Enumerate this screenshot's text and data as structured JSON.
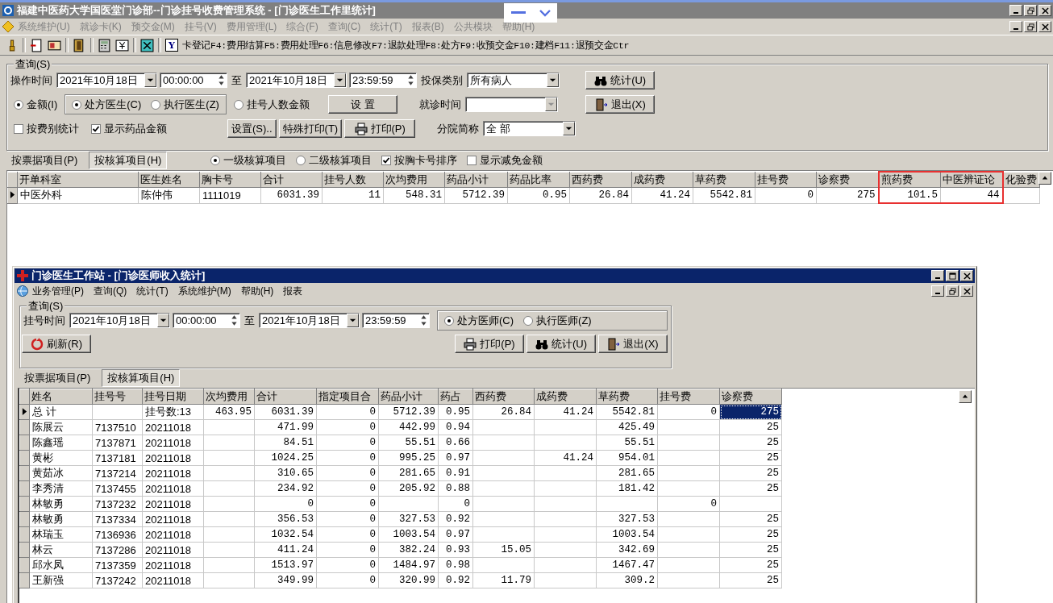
{
  "window": {
    "title": "福建中医药大学国医堂门诊部--门诊挂号收费管理系统 - [门诊医生工作里统计]"
  },
  "menu": [
    "系统维护(U)",
    "就诊卡(K)",
    "预交金(M)",
    "挂号(V)",
    "费用管理(L)",
    "综合(F)",
    "查询(C)",
    "统计(T)",
    "报表(B)",
    "公共模块",
    "帮助(H)"
  ],
  "toolbar": {
    "key_label": "Y",
    "shortcuts": "卡登记F4:费用结算F5:费用处理F6:信息修改F7:退款处理F8:处方F9:收预交金F10:建档F11:退预交金Ctr"
  },
  "query": {
    "legend": "查询(S)",
    "time_label": "操作时间",
    "date_from": "2021年10月18日",
    "time_from": "00:00:00",
    "to": "至",
    "date_to": "2021年10月18日",
    "time_to": "23:59:59",
    "insurance_label": "投保类别",
    "insurance": "所有病人",
    "stat_button": "统计(U)",
    "mode_radios": [
      {
        "label": "金额(I)",
        "selected": true
      },
      {
        "label": "挂号人数金额",
        "selected": false
      }
    ],
    "doctor_radios": [
      {
        "label": "处方医生(C)",
        "selected": true
      },
      {
        "label": "执行医生(Z)",
        "selected": false
      }
    ],
    "setup_button": "设 置",
    "visit_time_label": "就诊时间",
    "exit_button": "退出(X)",
    "checkboxes": [
      {
        "label": "按费别统计",
        "checked": false
      },
      {
        "label": "显示药品金额",
        "checked": true
      }
    ],
    "settings_button": "设置(S)..",
    "special_print_button": "特殊打印(T)",
    "print_button": "打印(P)",
    "branch_label": "分院简称",
    "branch": "全 部"
  },
  "tabs": [
    {
      "label": "按票据项目(P)",
      "selected": false
    },
    {
      "label": "按核算项目(H)",
      "selected": true
    }
  ],
  "level_radios": [
    {
      "label": "一级核算项目",
      "selected": true
    },
    {
      "label": "二级核算项目",
      "selected": false
    }
  ],
  "sort_checkboxes": [
    {
      "label": "按胸卡号排序",
      "checked": true
    },
    {
      "label": "显示减免金额",
      "checked": false
    }
  ],
  "main_grid": {
    "columns": [
      {
        "label": "开单科室",
        "kind": "text",
        "highlighted": false
      },
      {
        "label": "医生姓名",
        "kind": "text",
        "highlighted": false
      },
      {
        "label": "胸卡号",
        "kind": "text",
        "highlighted": false
      },
      {
        "label": "合计",
        "kind": "number",
        "highlighted": false
      },
      {
        "label": "挂号人数",
        "kind": "number",
        "highlighted": false
      },
      {
        "label": "次均费用",
        "kind": "number",
        "highlighted": false
      },
      {
        "label": "药品小计",
        "kind": "number",
        "highlighted": false
      },
      {
        "label": "药品比率",
        "kind": "number",
        "highlighted": false
      },
      {
        "label": "西药费",
        "kind": "number",
        "highlighted": false
      },
      {
        "label": "成药费",
        "kind": "number",
        "highlighted": false
      },
      {
        "label": "草药费",
        "kind": "number",
        "highlighted": false
      },
      {
        "label": "挂号费",
        "kind": "number",
        "highlighted": false
      },
      {
        "label": "诊察费",
        "kind": "number",
        "highlighted": false
      },
      {
        "label": "煎药费",
        "kind": "number",
        "highlighted": true
      },
      {
        "label": "中医辨证论",
        "kind": "number",
        "highlighted": true
      },
      {
        "label": "化验费",
        "kind": "number",
        "highlighted": false
      }
    ],
    "rows": [
      {
        "selected": true,
        "cells": [
          "中医外科",
          "陈仲伟",
          "1111019",
          "6031.39",
          "11",
          "548.31",
          "5712.39",
          "0.95",
          "26.84",
          "41.24",
          "5542.81",
          "0",
          "275",
          "101.5",
          "44",
          null
        ]
      }
    ]
  },
  "sub_window": {
    "title": "门诊医生工作站 - [门诊医师收入统计]",
    "menu": [
      "业务管理(P)",
      "查询(Q)",
      "统计(T)",
      "系统维护(M)",
      "帮助(H)",
      "报表"
    ],
    "query": {
      "legend": "查询(S)",
      "time_label": "挂号时间",
      "date_from": "2021年10月18日",
      "time_from": "00:00:00",
      "to": "至",
      "date_to": "2021年10月18日",
      "time_to": "23:59:59",
      "doctor_radios": [
        {
          "label": "处方医师(C)",
          "selected": true
        },
        {
          "label": "执行医师(Z)",
          "selected": false
        }
      ],
      "refresh_button": "刷新(R)",
      "print_button": "打印(P)",
      "stat_button": "统计(U)",
      "exit_button": "退出(X)"
    },
    "tabs": [
      {
        "label": "按票据项目(P)",
        "selected": false
      },
      {
        "label": "按核算项目(H)",
        "selected": true
      }
    ],
    "grid": {
      "columns": [
        {
          "label": "姓名",
          "kind": "text"
        },
        {
          "label": "挂号号",
          "kind": "text"
        },
        {
          "label": "挂号日期",
          "kind": "text"
        },
        {
          "label": "次均费用",
          "kind": "number"
        },
        {
          "label": "合计",
          "kind": "number"
        },
        {
          "label": "指定项目合",
          "kind": "number"
        },
        {
          "label": "药品小计",
          "kind": "number"
        },
        {
          "label": "药占",
          "kind": "number"
        },
        {
          "label": "西药费",
          "kind": "number"
        },
        {
          "label": "成药费",
          "kind": "number"
        },
        {
          "label": "草药费",
          "kind": "number"
        },
        {
          "label": "挂号费",
          "kind": "number"
        },
        {
          "label": "诊察费",
          "kind": "number"
        }
      ],
      "rows": [
        {
          "selected": true,
          "focused": true,
          "cells": [
            "总 计",
            null,
            "挂号数:13",
            "463.95",
            "6031.39",
            "0",
            "5712.39",
            "0.95",
            "26.84",
            "41.24",
            "5542.81",
            "0",
            "275"
          ]
        },
        {
          "selected": false,
          "focused": false,
          "cells": [
            "陈展云",
            "7137510",
            "20211018",
            null,
            "471.99",
            "0",
            "442.99",
            "0.94",
            null,
            null,
            "425.49",
            null,
            "25"
          ]
        },
        {
          "selected": false,
          "focused": false,
          "cells": [
            "陈鑫瑶",
            "7137871",
            "20211018",
            null,
            "84.51",
            "0",
            "55.51",
            "0.66",
            null,
            null,
            "55.51",
            null,
            "25"
          ]
        },
        {
          "selected": false,
          "focused": false,
          "cells": [
            "黄彬",
            "7137181",
            "20211018",
            null,
            "1024.25",
            "0",
            "995.25",
            "0.97",
            null,
            "41.24",
            "954.01",
            null,
            "25"
          ]
        },
        {
          "selected": false,
          "focused": false,
          "cells": [
            "黄茹冰",
            "7137214",
            "20211018",
            null,
            "310.65",
            "0",
            "281.65",
            "0.91",
            null,
            null,
            "281.65",
            null,
            "25"
          ]
        },
        {
          "selected": false,
          "focused": false,
          "cells": [
            "李秀清",
            "7137455",
            "20211018",
            null,
            "234.92",
            "0",
            "205.92",
            "0.88",
            null,
            null,
            "181.42",
            null,
            "25"
          ]
        },
        {
          "selected": false,
          "focused": false,
          "cells": [
            "林敏勇",
            "7137232",
            "20211018",
            null,
            "0",
            "0",
            null,
            "0",
            null,
            null,
            null,
            "0",
            null
          ]
        },
        {
          "selected": false,
          "focused": false,
          "cells": [
            "林敏勇",
            "7137334",
            "20211018",
            null,
            "356.53",
            "0",
            "327.53",
            "0.92",
            null,
            null,
            "327.53",
            null,
            "25"
          ]
        },
        {
          "selected": false,
          "focused": false,
          "cells": [
            "林瑞玉",
            "7136936",
            "20211018",
            null,
            "1032.54",
            "0",
            "1003.54",
            "0.97",
            null,
            null,
            "1003.54",
            null,
            "25"
          ]
        },
        {
          "selected": false,
          "focused": false,
          "cells": [
            "林云",
            "7137286",
            "20211018",
            null,
            "411.24",
            "0",
            "382.24",
            "0.93",
            "15.05",
            null,
            "342.69",
            null,
            "25"
          ]
        },
        {
          "selected": false,
          "focused": false,
          "cells": [
            "邱水凤",
            "7137359",
            "20211018",
            null,
            "1513.97",
            "0",
            "1484.97",
            "0.98",
            null,
            null,
            "1467.47",
            null,
            "25"
          ]
        },
        {
          "selected": false,
          "focused": false,
          "cells": [
            "王新强",
            "7137242",
            "20211018",
            null,
            "349.99",
            "0",
            "320.99",
            "0.92",
            "11.79",
            null,
            "309.2",
            null,
            "25"
          ]
        }
      ]
    }
  }
}
